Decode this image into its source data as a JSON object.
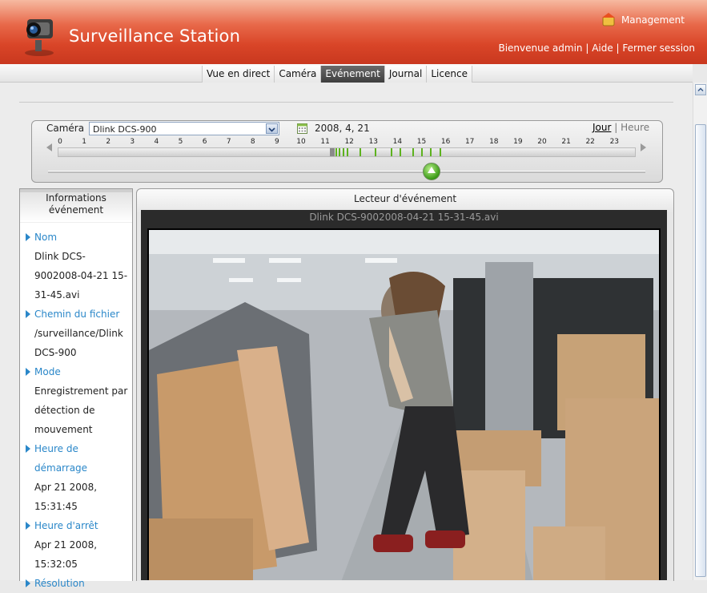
{
  "app": {
    "title": "Surveillance Station",
    "management_label": "Management",
    "user_links": {
      "welcome": "Bienvenue admin",
      "help": "Aide",
      "logout": "Fermer session"
    }
  },
  "nav": {
    "tabs": [
      {
        "label": "Vue en direct",
        "active": false
      },
      {
        "label": "Caméra",
        "active": false
      },
      {
        "label": "Evénement",
        "active": true
      },
      {
        "label": "Journal",
        "active": false
      },
      {
        "label": "Licence",
        "active": false
      }
    ]
  },
  "timeline": {
    "camera_label": "Caméra",
    "camera_selected": "Dlink DCS-900",
    "date": "2008, 4, 21",
    "view_day": "Jour",
    "view_separator": "|",
    "view_hour": "Heure",
    "hours": [
      "0",
      "1",
      "2",
      "3",
      "4",
      "5",
      "6",
      "7",
      "8",
      "9",
      "10",
      "11",
      "12",
      "13",
      "14",
      "15",
      "16",
      "17",
      "18",
      "19",
      "20",
      "21",
      "22",
      "23"
    ]
  },
  "info_panel": {
    "title": "Informations événement",
    "fields": [
      {
        "label": "Nom",
        "value": "Dlink DCS-9002008-04-21 15-31-45.avi"
      },
      {
        "label": "Chemin du fichier",
        "value": "/surveillance/Dlink DCS-900"
      },
      {
        "label": "Mode",
        "value": "Enregistrement par détection de mouvement"
      },
      {
        "label": "Heure de démarrage",
        "value": "Apr 21 2008, 15:31:45"
      },
      {
        "label": "Heure d'arrêt",
        "value": "Apr 21 2008, 15:32:05"
      },
      {
        "label": "Résolution",
        "value": ""
      }
    ]
  },
  "player": {
    "title": "Lecteur d'événement",
    "file_name": "Dlink DCS-9002008-04-21 15-31-45.avi"
  },
  "colors": {
    "header_red": "#d94528",
    "active_tab": "#4a4a4a",
    "link_blue": "#2a87c9",
    "event_green": "#5db21e"
  }
}
